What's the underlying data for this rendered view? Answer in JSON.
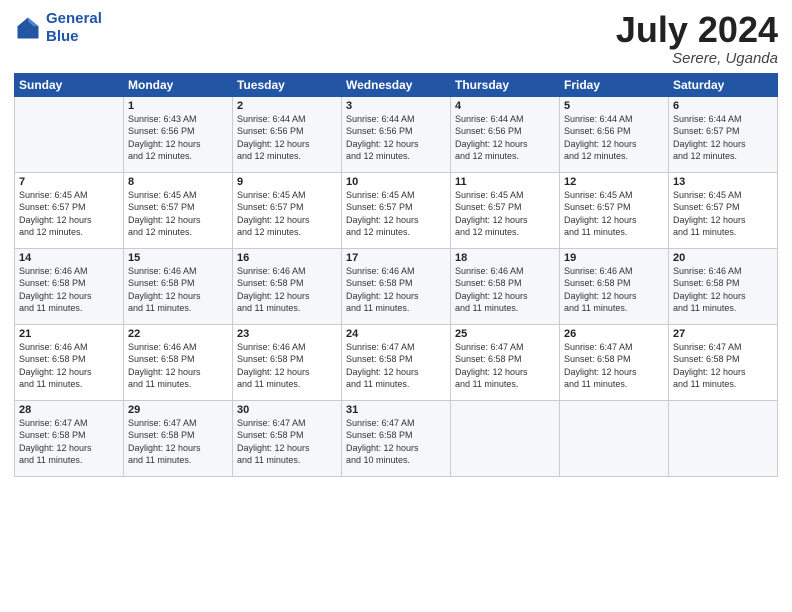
{
  "header": {
    "logo_line1": "General",
    "logo_line2": "Blue",
    "month": "July 2024",
    "location": "Serere, Uganda"
  },
  "days_of_week": [
    "Sunday",
    "Monday",
    "Tuesday",
    "Wednesday",
    "Thursday",
    "Friday",
    "Saturday"
  ],
  "weeks": [
    [
      {
        "day": "",
        "info": ""
      },
      {
        "day": "1",
        "info": "Sunrise: 6:43 AM\nSunset: 6:56 PM\nDaylight: 12 hours\nand 12 minutes."
      },
      {
        "day": "2",
        "info": "Sunrise: 6:44 AM\nSunset: 6:56 PM\nDaylight: 12 hours\nand 12 minutes."
      },
      {
        "day": "3",
        "info": "Sunrise: 6:44 AM\nSunset: 6:56 PM\nDaylight: 12 hours\nand 12 minutes."
      },
      {
        "day": "4",
        "info": "Sunrise: 6:44 AM\nSunset: 6:56 PM\nDaylight: 12 hours\nand 12 minutes."
      },
      {
        "day": "5",
        "info": "Sunrise: 6:44 AM\nSunset: 6:56 PM\nDaylight: 12 hours\nand 12 minutes."
      },
      {
        "day": "6",
        "info": "Sunrise: 6:44 AM\nSunset: 6:57 PM\nDaylight: 12 hours\nand 12 minutes."
      }
    ],
    [
      {
        "day": "7",
        "info": "Sunrise: 6:45 AM\nSunset: 6:57 PM\nDaylight: 12 hours\nand 12 minutes."
      },
      {
        "day": "8",
        "info": "Sunrise: 6:45 AM\nSunset: 6:57 PM\nDaylight: 12 hours\nand 12 minutes."
      },
      {
        "day": "9",
        "info": "Sunrise: 6:45 AM\nSunset: 6:57 PM\nDaylight: 12 hours\nand 12 minutes."
      },
      {
        "day": "10",
        "info": "Sunrise: 6:45 AM\nSunset: 6:57 PM\nDaylight: 12 hours\nand 12 minutes."
      },
      {
        "day": "11",
        "info": "Sunrise: 6:45 AM\nSunset: 6:57 PM\nDaylight: 12 hours\nand 12 minutes."
      },
      {
        "day": "12",
        "info": "Sunrise: 6:45 AM\nSunset: 6:57 PM\nDaylight: 12 hours\nand 11 minutes."
      },
      {
        "day": "13",
        "info": "Sunrise: 6:45 AM\nSunset: 6:57 PM\nDaylight: 12 hours\nand 11 minutes."
      }
    ],
    [
      {
        "day": "14",
        "info": "Sunrise: 6:46 AM\nSunset: 6:58 PM\nDaylight: 12 hours\nand 11 minutes."
      },
      {
        "day": "15",
        "info": "Sunrise: 6:46 AM\nSunset: 6:58 PM\nDaylight: 12 hours\nand 11 minutes."
      },
      {
        "day": "16",
        "info": "Sunrise: 6:46 AM\nSunset: 6:58 PM\nDaylight: 12 hours\nand 11 minutes."
      },
      {
        "day": "17",
        "info": "Sunrise: 6:46 AM\nSunset: 6:58 PM\nDaylight: 12 hours\nand 11 minutes."
      },
      {
        "day": "18",
        "info": "Sunrise: 6:46 AM\nSunset: 6:58 PM\nDaylight: 12 hours\nand 11 minutes."
      },
      {
        "day": "19",
        "info": "Sunrise: 6:46 AM\nSunset: 6:58 PM\nDaylight: 12 hours\nand 11 minutes."
      },
      {
        "day": "20",
        "info": "Sunrise: 6:46 AM\nSunset: 6:58 PM\nDaylight: 12 hours\nand 11 minutes."
      }
    ],
    [
      {
        "day": "21",
        "info": "Sunrise: 6:46 AM\nSunset: 6:58 PM\nDaylight: 12 hours\nand 11 minutes."
      },
      {
        "day": "22",
        "info": "Sunrise: 6:46 AM\nSunset: 6:58 PM\nDaylight: 12 hours\nand 11 minutes."
      },
      {
        "day": "23",
        "info": "Sunrise: 6:46 AM\nSunset: 6:58 PM\nDaylight: 12 hours\nand 11 minutes."
      },
      {
        "day": "24",
        "info": "Sunrise: 6:47 AM\nSunset: 6:58 PM\nDaylight: 12 hours\nand 11 minutes."
      },
      {
        "day": "25",
        "info": "Sunrise: 6:47 AM\nSunset: 6:58 PM\nDaylight: 12 hours\nand 11 minutes."
      },
      {
        "day": "26",
        "info": "Sunrise: 6:47 AM\nSunset: 6:58 PM\nDaylight: 12 hours\nand 11 minutes."
      },
      {
        "day": "27",
        "info": "Sunrise: 6:47 AM\nSunset: 6:58 PM\nDaylight: 12 hours\nand 11 minutes."
      }
    ],
    [
      {
        "day": "28",
        "info": "Sunrise: 6:47 AM\nSunset: 6:58 PM\nDaylight: 12 hours\nand 11 minutes."
      },
      {
        "day": "29",
        "info": "Sunrise: 6:47 AM\nSunset: 6:58 PM\nDaylight: 12 hours\nand 11 minutes."
      },
      {
        "day": "30",
        "info": "Sunrise: 6:47 AM\nSunset: 6:58 PM\nDaylight: 12 hours\nand 11 minutes."
      },
      {
        "day": "31",
        "info": "Sunrise: 6:47 AM\nSunset: 6:58 PM\nDaylight: 12 hours\nand 10 minutes."
      },
      {
        "day": "",
        "info": ""
      },
      {
        "day": "",
        "info": ""
      },
      {
        "day": "",
        "info": ""
      }
    ]
  ]
}
